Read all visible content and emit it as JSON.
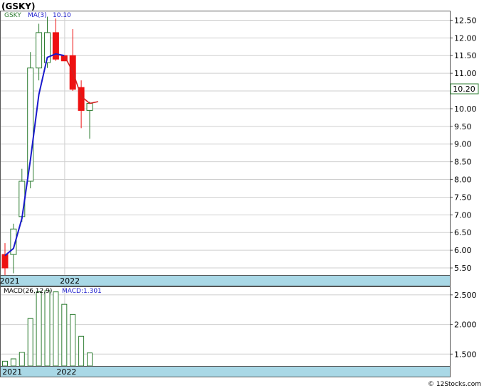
{
  "title": "(GSKY)",
  "colors": {
    "up": "#2e7d32",
    "down": "#ee1111",
    "ma_before": "#1a1acc",
    "ma_after": "#d42020",
    "macd": "#2e7d32",
    "date_bar": "#a9d8e6",
    "grid": "#cfcfcf",
    "last_price_box": "#2e7d32"
  },
  "watermark": "© 12Stocks.com",
  "chart_data": [
    {
      "type": "candlestick",
      "name": "price",
      "legend": {
        "symbol": "GSKY",
        "ma_label": "MA(3)",
        "ma_value": "10.10"
      },
      "last_price_label": "10.20",
      "yticks": [
        "12.50",
        "12.00",
        "11.50",
        "11.00",
        "10.50",
        "10.00",
        "9.50",
        "9.00",
        "8.50",
        "8.00",
        "7.50",
        "7.00",
        "6.50",
        "6.00",
        "5.50"
      ],
      "ylim": [
        5.3,
        12.75
      ],
      "x_labels": [
        {
          "label": "2021",
          "index": -0.2
        },
        {
          "label": "2022",
          "index": 6.9
        }
      ],
      "grid": true,
      "candles": [
        {
          "o": 5.88,
          "h": 6.2,
          "l": 5.3,
          "c": 5.5
        },
        {
          "o": 5.88,
          "h": 6.75,
          "l": 5.35,
          "c": 6.6
        },
        {
          "o": 6.95,
          "h": 8.3,
          "l": 6.8,
          "c": 7.95
        },
        {
          "o": 7.95,
          "h": 11.6,
          "l": 7.75,
          "c": 11.15
        },
        {
          "o": 11.15,
          "h": 12.4,
          "l": 10.8,
          "c": 12.15
        },
        {
          "o": 11.3,
          "h": 12.6,
          "l": 11.15,
          "c": 12.15
        },
        {
          "o": 12.15,
          "h": 12.55,
          "l": 11.35,
          "c": 11.4
        },
        {
          "o": 11.5,
          "h": 11.5,
          "l": 11.35,
          "c": 11.35
        },
        {
          "o": 11.5,
          "h": 12.25,
          "l": 10.5,
          "c": 10.55
        },
        {
          "o": 10.6,
          "h": 10.8,
          "l": 9.45,
          "c": 9.95
        },
        {
          "o": 9.95,
          "h": 10.2,
          "l": 9.15,
          "c": 10.15
        }
      ],
      "ma": [
        {
          "i": 0,
          "v": 5.85
        },
        {
          "i": 1,
          "v": 6.05
        },
        {
          "i": 2,
          "v": 6.9
        },
        {
          "i": 3,
          "v": 8.55
        },
        {
          "i": 4,
          "v": 10.4
        },
        {
          "i": 5,
          "v": 11.45
        },
        {
          "i": 6,
          "v": 11.55
        },
        {
          "i": 7,
          "v": 11.5
        },
        {
          "i": 8,
          "v": 11.05
        },
        {
          "i": 9,
          "v": 10.35
        },
        {
          "i": 10,
          "v": 10.15
        },
        {
          "i": 11,
          "v": 10.2
        }
      ],
      "ma_color_switch_index": 7
    },
    {
      "type": "bar",
      "name": "macd",
      "legend": {
        "label": "MACD(26,12,9)",
        "value_label": "MACD:1.301"
      },
      "yticks": [
        "2.500",
        "2.000",
        "1.500"
      ],
      "ylim": [
        1.3,
        2.63
      ],
      "x_labels": [
        {
          "label": "2021",
          "index": 0.1
        },
        {
          "label": "2022",
          "index": 6.5
        }
      ],
      "values": [
        1.38,
        1.42,
        1.53,
        2.1,
        2.55,
        2.57,
        2.55,
        2.34,
        2.17,
        1.8,
        1.52
      ]
    }
  ]
}
